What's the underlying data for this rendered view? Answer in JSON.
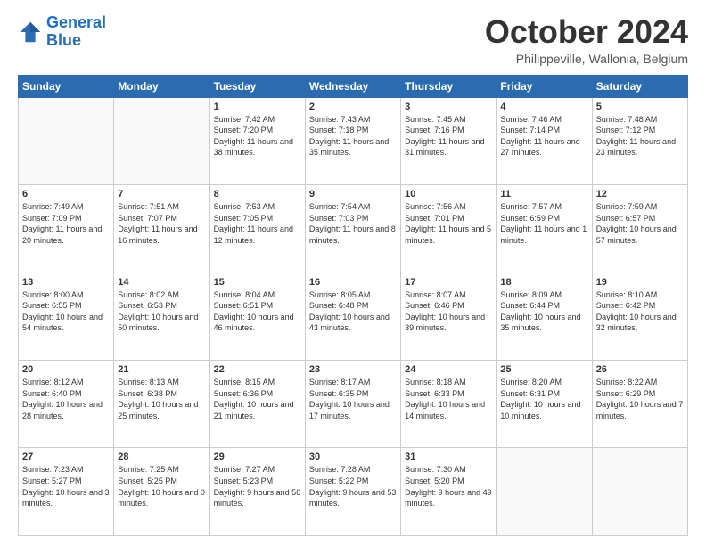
{
  "header": {
    "logo_line1": "General",
    "logo_line2": "Blue",
    "month": "October 2024",
    "location": "Philippeville, Wallonia, Belgium"
  },
  "weekdays": [
    "Sunday",
    "Monday",
    "Tuesday",
    "Wednesday",
    "Thursday",
    "Friday",
    "Saturday"
  ],
  "weeks": [
    [
      {
        "day": "",
        "sunrise": "",
        "sunset": "",
        "daylight": ""
      },
      {
        "day": "",
        "sunrise": "",
        "sunset": "",
        "daylight": ""
      },
      {
        "day": "1",
        "sunrise": "Sunrise: 7:42 AM",
        "sunset": "Sunset: 7:20 PM",
        "daylight": "Daylight: 11 hours and 38 minutes."
      },
      {
        "day": "2",
        "sunrise": "Sunrise: 7:43 AM",
        "sunset": "Sunset: 7:18 PM",
        "daylight": "Daylight: 11 hours and 35 minutes."
      },
      {
        "day": "3",
        "sunrise": "Sunrise: 7:45 AM",
        "sunset": "Sunset: 7:16 PM",
        "daylight": "Daylight: 11 hours and 31 minutes."
      },
      {
        "day": "4",
        "sunrise": "Sunrise: 7:46 AM",
        "sunset": "Sunset: 7:14 PM",
        "daylight": "Daylight: 11 hours and 27 minutes."
      },
      {
        "day": "5",
        "sunrise": "Sunrise: 7:48 AM",
        "sunset": "Sunset: 7:12 PM",
        "daylight": "Daylight: 11 hours and 23 minutes."
      }
    ],
    [
      {
        "day": "6",
        "sunrise": "Sunrise: 7:49 AM",
        "sunset": "Sunset: 7:09 PM",
        "daylight": "Daylight: 11 hours and 20 minutes."
      },
      {
        "day": "7",
        "sunrise": "Sunrise: 7:51 AM",
        "sunset": "Sunset: 7:07 PM",
        "daylight": "Daylight: 11 hours and 16 minutes."
      },
      {
        "day": "8",
        "sunrise": "Sunrise: 7:53 AM",
        "sunset": "Sunset: 7:05 PM",
        "daylight": "Daylight: 11 hours and 12 minutes."
      },
      {
        "day": "9",
        "sunrise": "Sunrise: 7:54 AM",
        "sunset": "Sunset: 7:03 PM",
        "daylight": "Daylight: 11 hours and 8 minutes."
      },
      {
        "day": "10",
        "sunrise": "Sunrise: 7:56 AM",
        "sunset": "Sunset: 7:01 PM",
        "daylight": "Daylight: 11 hours and 5 minutes."
      },
      {
        "day": "11",
        "sunrise": "Sunrise: 7:57 AM",
        "sunset": "Sunset: 6:59 PM",
        "daylight": "Daylight: 11 hours and 1 minute."
      },
      {
        "day": "12",
        "sunrise": "Sunrise: 7:59 AM",
        "sunset": "Sunset: 6:57 PM",
        "daylight": "Daylight: 10 hours and 57 minutes."
      }
    ],
    [
      {
        "day": "13",
        "sunrise": "Sunrise: 8:00 AM",
        "sunset": "Sunset: 6:55 PM",
        "daylight": "Daylight: 10 hours and 54 minutes."
      },
      {
        "day": "14",
        "sunrise": "Sunrise: 8:02 AM",
        "sunset": "Sunset: 6:53 PM",
        "daylight": "Daylight: 10 hours and 50 minutes."
      },
      {
        "day": "15",
        "sunrise": "Sunrise: 8:04 AM",
        "sunset": "Sunset: 6:51 PM",
        "daylight": "Daylight: 10 hours and 46 minutes."
      },
      {
        "day": "16",
        "sunrise": "Sunrise: 8:05 AM",
        "sunset": "Sunset: 6:48 PM",
        "daylight": "Daylight: 10 hours and 43 minutes."
      },
      {
        "day": "17",
        "sunrise": "Sunrise: 8:07 AM",
        "sunset": "Sunset: 6:46 PM",
        "daylight": "Daylight: 10 hours and 39 minutes."
      },
      {
        "day": "18",
        "sunrise": "Sunrise: 8:09 AM",
        "sunset": "Sunset: 6:44 PM",
        "daylight": "Daylight: 10 hours and 35 minutes."
      },
      {
        "day": "19",
        "sunrise": "Sunrise: 8:10 AM",
        "sunset": "Sunset: 6:42 PM",
        "daylight": "Daylight: 10 hours and 32 minutes."
      }
    ],
    [
      {
        "day": "20",
        "sunrise": "Sunrise: 8:12 AM",
        "sunset": "Sunset: 6:40 PM",
        "daylight": "Daylight: 10 hours and 28 minutes."
      },
      {
        "day": "21",
        "sunrise": "Sunrise: 8:13 AM",
        "sunset": "Sunset: 6:38 PM",
        "daylight": "Daylight: 10 hours and 25 minutes."
      },
      {
        "day": "22",
        "sunrise": "Sunrise: 8:15 AM",
        "sunset": "Sunset: 6:36 PM",
        "daylight": "Daylight: 10 hours and 21 minutes."
      },
      {
        "day": "23",
        "sunrise": "Sunrise: 8:17 AM",
        "sunset": "Sunset: 6:35 PM",
        "daylight": "Daylight: 10 hours and 17 minutes."
      },
      {
        "day": "24",
        "sunrise": "Sunrise: 8:18 AM",
        "sunset": "Sunset: 6:33 PM",
        "daylight": "Daylight: 10 hours and 14 minutes."
      },
      {
        "day": "25",
        "sunrise": "Sunrise: 8:20 AM",
        "sunset": "Sunset: 6:31 PM",
        "daylight": "Daylight: 10 hours and 10 minutes."
      },
      {
        "day": "26",
        "sunrise": "Sunrise: 8:22 AM",
        "sunset": "Sunset: 6:29 PM",
        "daylight": "Daylight: 10 hours and 7 minutes."
      }
    ],
    [
      {
        "day": "27",
        "sunrise": "Sunrise: 7:23 AM",
        "sunset": "Sunset: 5:27 PM",
        "daylight": "Daylight: 10 hours and 3 minutes."
      },
      {
        "day": "28",
        "sunrise": "Sunrise: 7:25 AM",
        "sunset": "Sunset: 5:25 PM",
        "daylight": "Daylight: 10 hours and 0 minutes."
      },
      {
        "day": "29",
        "sunrise": "Sunrise: 7:27 AM",
        "sunset": "Sunset: 5:23 PM",
        "daylight": "Daylight: 9 hours and 56 minutes."
      },
      {
        "day": "30",
        "sunrise": "Sunrise: 7:28 AM",
        "sunset": "Sunset: 5:22 PM",
        "daylight": "Daylight: 9 hours and 53 minutes."
      },
      {
        "day": "31",
        "sunrise": "Sunrise: 7:30 AM",
        "sunset": "Sunset: 5:20 PM",
        "daylight": "Daylight: 9 hours and 49 minutes."
      },
      {
        "day": "",
        "sunrise": "",
        "sunset": "",
        "daylight": ""
      },
      {
        "day": "",
        "sunrise": "",
        "sunset": "",
        "daylight": ""
      }
    ]
  ]
}
